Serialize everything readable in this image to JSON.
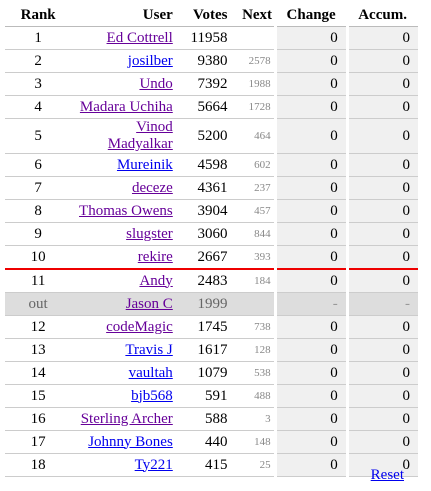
{
  "headers": {
    "rank": "Rank",
    "user": "User",
    "votes": "Votes",
    "next": "Next",
    "change": "Change",
    "accum": "Accum."
  },
  "rows": [
    {
      "rank": "1",
      "user": "Ed Cottrell",
      "votes": "11958",
      "next": "",
      "change": "0",
      "accum": "0",
      "visited": true
    },
    {
      "rank": "2",
      "user": "josilber",
      "votes": "9380",
      "next": "2578",
      "change": "0",
      "accum": "0",
      "visited": false
    },
    {
      "rank": "3",
      "user": "Undo",
      "votes": "7392",
      "next": "1988",
      "change": "0",
      "accum": "0",
      "visited": true
    },
    {
      "rank": "4",
      "user": "Madara Uchiha",
      "votes": "5664",
      "next": "1728",
      "change": "0",
      "accum": "0",
      "visited": true
    },
    {
      "rank": "5",
      "user": "Vinod Madyalkar",
      "votes": "5200",
      "next": "464",
      "change": "0",
      "accum": "0",
      "visited": true
    },
    {
      "rank": "6",
      "user": "Mureinik",
      "votes": "4598",
      "next": "602",
      "change": "0",
      "accum": "0",
      "visited": false
    },
    {
      "rank": "7",
      "user": "deceze",
      "votes": "4361",
      "next": "237",
      "change": "0",
      "accum": "0",
      "visited": true
    },
    {
      "rank": "8",
      "user": "Thomas Owens",
      "votes": "3904",
      "next": "457",
      "change": "0",
      "accum": "0",
      "visited": true
    },
    {
      "rank": "9",
      "user": "slugster",
      "votes": "3060",
      "next": "844",
      "change": "0",
      "accum": "0",
      "visited": true
    },
    {
      "rank": "10",
      "user": "rekire",
      "votes": "2667",
      "next": "393",
      "change": "0",
      "accum": "0",
      "visited": true,
      "cutoff": true
    },
    {
      "rank": "11",
      "user": "Andy",
      "votes": "2483",
      "next": "184",
      "change": "0",
      "accum": "0",
      "visited": true
    },
    {
      "rank": "out",
      "user": "Jason C",
      "votes": "1999",
      "next": "",
      "change": "-",
      "accum": "-",
      "visited": true,
      "out": true
    },
    {
      "rank": "12",
      "user": "codeMagic",
      "votes": "1745",
      "next": "738",
      "change": "0",
      "accum": "0",
      "visited": true
    },
    {
      "rank": "13",
      "user": "Travis J",
      "votes": "1617",
      "next": "128",
      "change": "0",
      "accum": "0",
      "visited": false
    },
    {
      "rank": "14",
      "user": "vaultah",
      "votes": "1079",
      "next": "538",
      "change": "0",
      "accum": "0",
      "visited": false
    },
    {
      "rank": "15",
      "user": "bjb568",
      "votes": "591",
      "next": "488",
      "change": "0",
      "accum": "0",
      "visited": false
    },
    {
      "rank": "16",
      "user": "Sterling Archer",
      "votes": "588",
      "next": "3",
      "change": "0",
      "accum": "0",
      "visited": true
    },
    {
      "rank": "17",
      "user": "Johnny Bones",
      "votes": "440",
      "next": "148",
      "change": "0",
      "accum": "0",
      "visited": false
    },
    {
      "rank": "18",
      "user": "Ty221",
      "votes": "415",
      "next": "25",
      "change": "0",
      "accum": "0",
      "visited": false
    }
  ],
  "reset_label": "Reset"
}
